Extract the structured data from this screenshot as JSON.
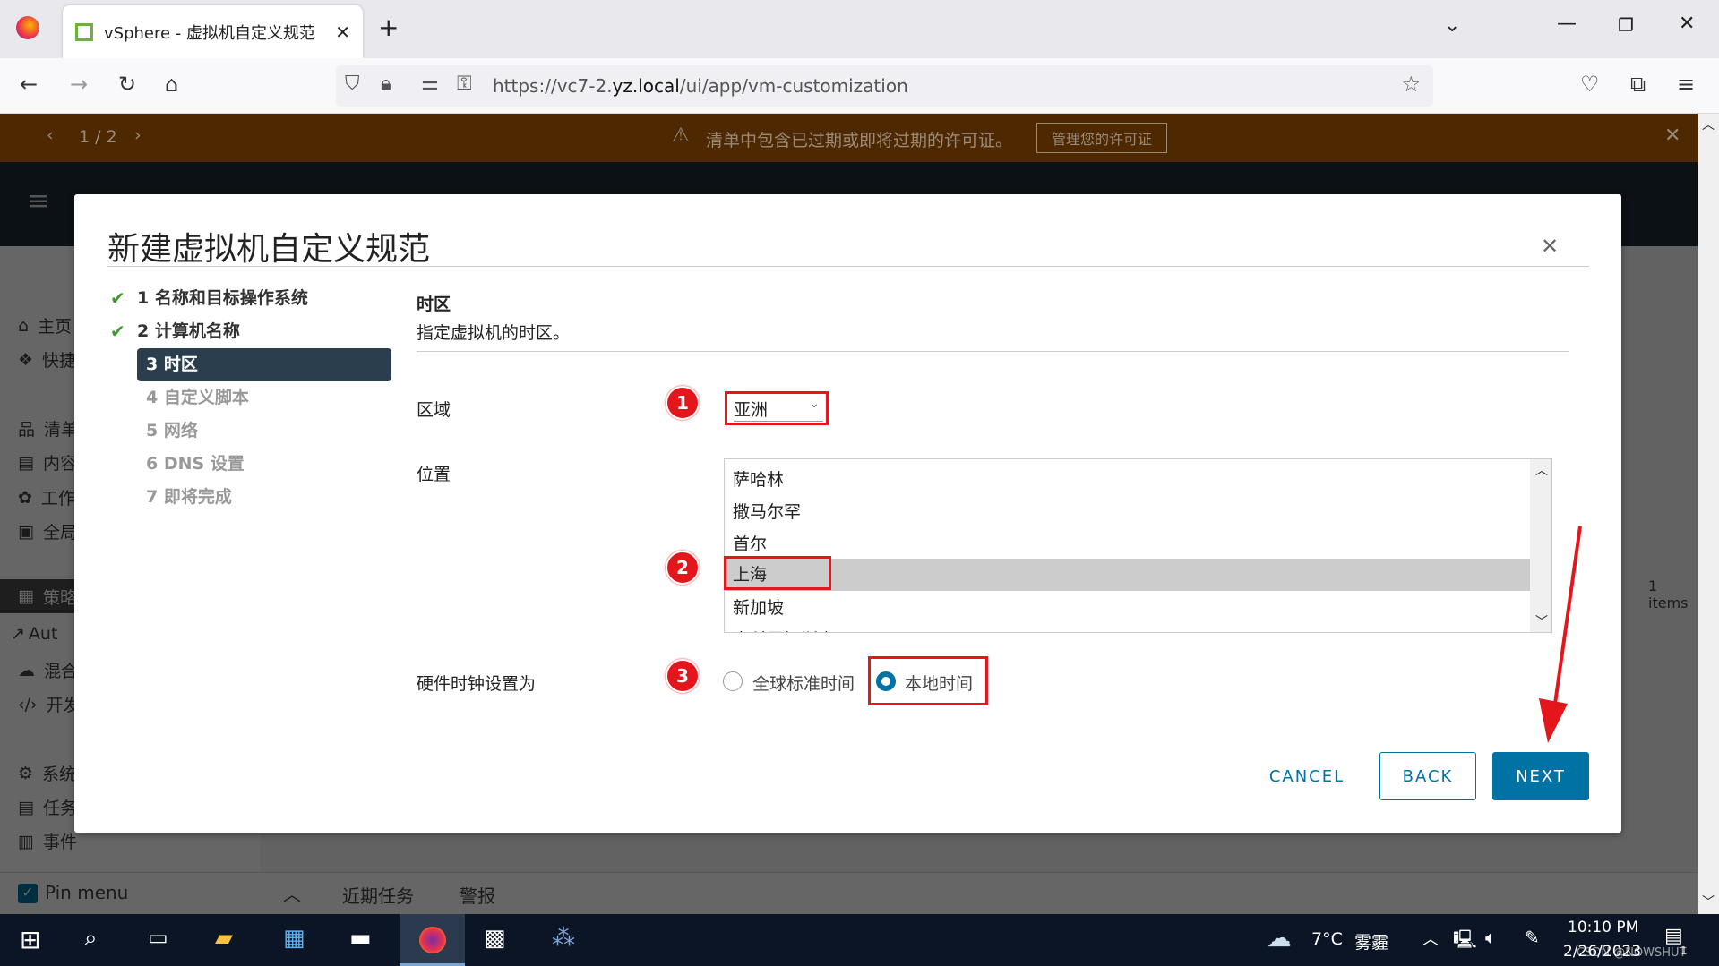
{
  "browser": {
    "tab_title": "vSphere - 虚拟机自定义规范",
    "url_host_prefix": "https://vc7-2.",
    "url_host": "yz.local",
    "url_path": "/ui/app/vm-customization"
  },
  "banner": {
    "pager": "1 / 2",
    "message": "清单中包含已过期或即将过期的许可证。",
    "manage_button": "管理您的许可证"
  },
  "sidebar": {
    "items": [
      "主页",
      "快捷",
      "清单",
      "内容",
      "工作",
      "全局",
      "策略",
      "Aut",
      "混合",
      "开发",
      "系统",
      "任务",
      "事件"
    ],
    "pin_menu": "Pin menu"
  },
  "bottom_tabs": [
    "近期任务",
    "警报"
  ],
  "background": {
    "items_count": "1 items"
  },
  "modal": {
    "title": "新建虚拟机自定义规范",
    "steps": [
      {
        "label": "1 名称和目标操作系统",
        "state": "done"
      },
      {
        "label": "2 计算机名称",
        "state": "done"
      },
      {
        "label": "3 时区",
        "state": "active"
      },
      {
        "label": "4 自定义脚本",
        "state": "todo"
      },
      {
        "label": "5 网络",
        "state": "todo"
      },
      {
        "label": "6 DNS 设置",
        "state": "todo"
      },
      {
        "label": "7 即将完成",
        "state": "todo"
      }
    ],
    "section_title": "时区",
    "section_desc": "指定虚拟机的时区。",
    "area_label": "区域",
    "area_value": "亚洲",
    "location_label": "位置",
    "locations": [
      "萨哈林",
      "撒马尔罕",
      "首尔",
      "上海",
      "新加坡",
      "中科雷姆斯克"
    ],
    "selected_location": "上海",
    "clock_label": "硬件时钟设置为",
    "clock_options": [
      "全球标准时间",
      "本地时间"
    ],
    "clock_selected": "本地时间",
    "annotations": [
      "1",
      "2",
      "3"
    ],
    "cancel": "CANCEL",
    "back": "BACK",
    "next": "NEXT"
  },
  "taskbar": {
    "weather_temp": "7°C",
    "weather_desc": "雾霾",
    "time": "10:10 PM",
    "date": "2/26/2023",
    "notifications": "1",
    "watermark": "CSDN @NOWSHUT"
  },
  "colors": {
    "accent": "#0072a3",
    "annotation": "#e4161b",
    "banner": "#c46400",
    "active_step": "#2b3e4d"
  }
}
